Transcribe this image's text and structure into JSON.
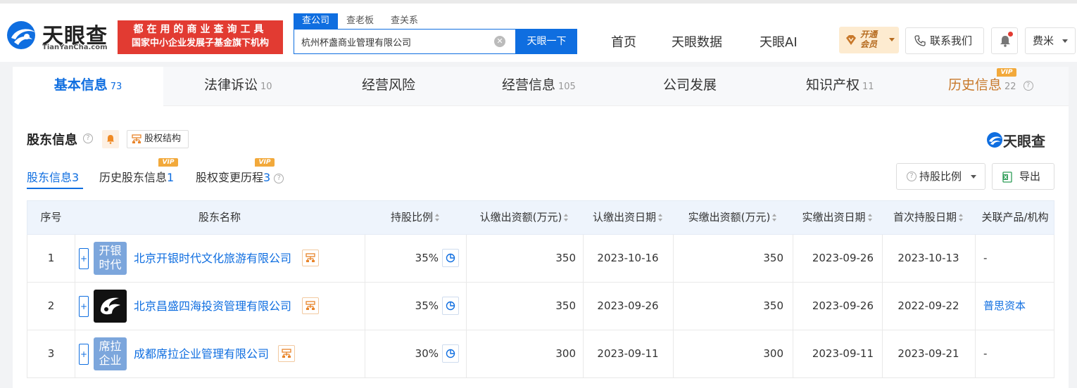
{
  "header": {
    "brand": "天眼查",
    "domain": "TianYanCha.com",
    "slogan_line1": "都在用的商业查询工具",
    "slogan_line2": "国家中小企业发展子基金旗下机构",
    "search_tabs": [
      "查公司",
      "查老板",
      "查关系"
    ],
    "search_value": "杭州杯盏商业管理有限公司",
    "search_button": "天眼一下",
    "nav": [
      "首页",
      "天眼数据",
      "天眼AI"
    ],
    "vip_line1": "开通",
    "vip_line2": "会员",
    "contact": "联系我们",
    "user": "费米"
  },
  "tabs": [
    {
      "label": "基本信息",
      "count": "73"
    },
    {
      "label": "法律诉讼",
      "count": "10"
    },
    {
      "label": "经营风险",
      "count": ""
    },
    {
      "label": "经营信息",
      "count": "105"
    },
    {
      "label": "公司发展",
      "count": ""
    },
    {
      "label": "知识产权",
      "count": "11"
    },
    {
      "label": "历史信息",
      "count": "22"
    }
  ],
  "vip_tag": "VIP",
  "section": {
    "title": "股东信息",
    "equity_btn": "股权结构",
    "brand": "天眼查",
    "subtabs": [
      {
        "label": "股东信息",
        "count": "3"
      },
      {
        "label": "历史股东信息",
        "count": "1"
      },
      {
        "label": "股权变更历程",
        "count": "3"
      }
    ],
    "ratio_btn": "持股比例",
    "export_btn": "导出"
  },
  "table": {
    "headers": [
      "序号",
      "股东名称",
      "持股比例",
      "认缴出资额(万元)",
      "认缴出资日期",
      "实缴出资额(万元)",
      "实缴出资日期",
      "首次持股日期",
      "关联产品/机构"
    ],
    "rows": [
      {
        "idx": "1",
        "avatar": "开银时代",
        "name": "北京开银时代文化旅游有限公司",
        "ratio": "35%",
        "sub_amt": "350",
        "sub_date": "2023-10-16",
        "paid_amt": "350",
        "paid_date": "2023-09-26",
        "first_date": "2023-10-13",
        "related": "-"
      },
      {
        "idx": "2",
        "avatar": "",
        "name": "北京昌盛四海投资管理有限公司",
        "ratio": "35%",
        "sub_amt": "350",
        "sub_date": "2023-09-26",
        "paid_amt": "350",
        "paid_date": "2023-09-26",
        "first_date": "2022-09-22",
        "related": "普思资本"
      },
      {
        "idx": "3",
        "avatar": "席拉企业",
        "name": "成都席拉企业管理有限公司",
        "ratio": "30%",
        "sub_amt": "300",
        "sub_date": "2023-09-11",
        "paid_amt": "300",
        "paid_date": "2023-09-11",
        "first_date": "2023-09-21",
        "related": "-"
      }
    ]
  },
  "colors": {
    "primary": "#0f6ee0",
    "slogan_bg": "#e23b32",
    "vip": "#f2a93b",
    "history": "#c8782a"
  }
}
